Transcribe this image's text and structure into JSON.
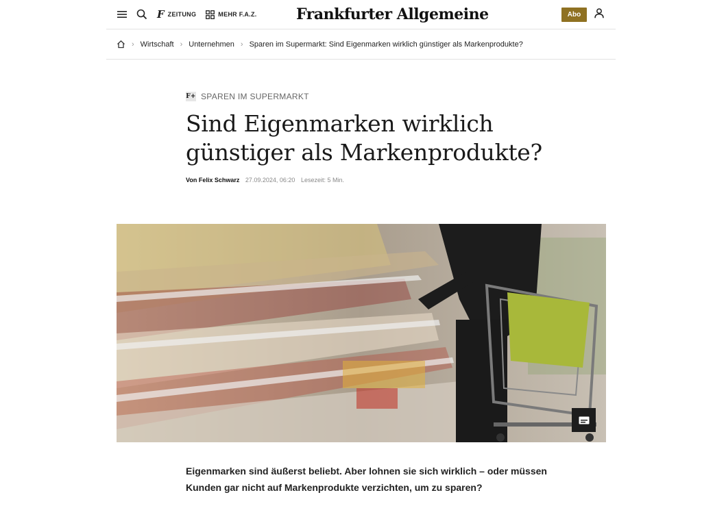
{
  "header": {
    "menu_icon": "hamburger-menu-icon",
    "search_icon": "search-icon",
    "zeitung_label": "ZEITUNG",
    "mehr_label": "MEHR F.A.Z.",
    "logo_text": "Frankfurter Allgemeine",
    "abo_label": "Abo",
    "user_icon": "user-icon"
  },
  "breadcrumb": {
    "home_icon": "home-icon",
    "items": [
      "Wirtschaft",
      "Unternehmen",
      "Sparen im Supermarkt: Sind Eigenmarken wirklich günstiger als Markenprodukte?"
    ]
  },
  "article": {
    "kicker": "SPAREN IM SUPERMARKT",
    "kicker_badge": "F+",
    "headline": "Sind Eigenmarken wirklich günstiger als Markenprodukte?",
    "author": "Von Felix Schwarz",
    "date": "27.09.2024, 06:20",
    "reading_time": "Lesezeit: 5 Min.",
    "caption_icon": "caption-icon",
    "lead": "Eigenmarken sind äußerst beliebt. Aber lohnen sie sich wirklich – oder müssen Kunden gar nicht auf Markenprodukte verzichten, um zu sparen?"
  },
  "colors": {
    "accent": "#8f7122",
    "text": "#1a1a1a",
    "meta": "#888888",
    "divider": "#e2e2e2"
  }
}
